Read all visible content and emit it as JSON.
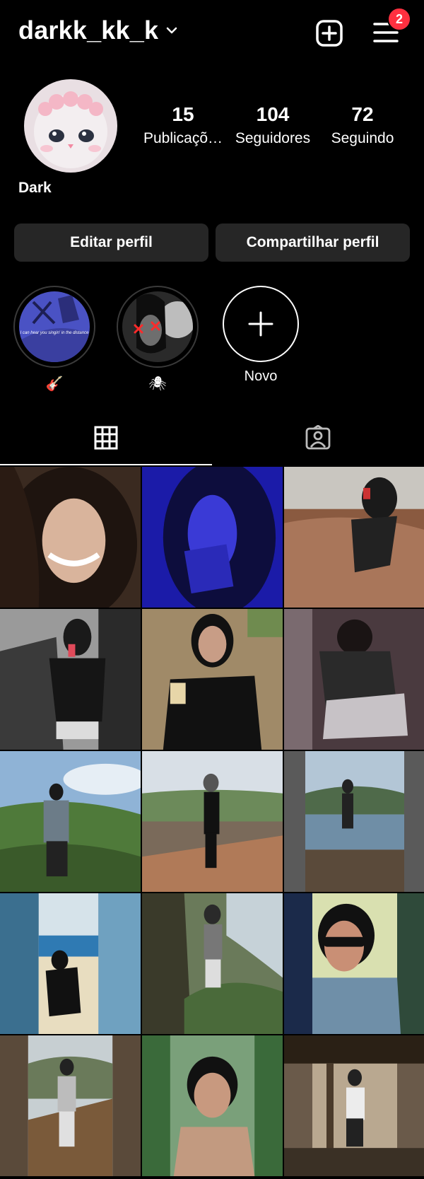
{
  "header": {
    "username": "darkk_kk_k",
    "notification_count": "2",
    "icons": [
      "chevron-down-icon",
      "add-post-icon",
      "menu-icon"
    ]
  },
  "profile": {
    "display_name": "Dark",
    "stats": [
      {
        "value": "15",
        "label": "Publicaçõ…"
      },
      {
        "value": "104",
        "label": "Seguidores"
      },
      {
        "value": "72",
        "label": "Seguindo"
      }
    ]
  },
  "buttons": {
    "edit": "Editar perfil",
    "share": "Compartilhar perfil"
  },
  "highlights": [
    {
      "label": "🎸",
      "image_text": "I can hear you singin' in the distance"
    },
    {
      "label": "🕷"
    },
    {
      "label": "Novo"
    }
  ],
  "tabs": [
    {
      "name": "grid-tab",
      "icon": "grid-icon",
      "active": true
    },
    {
      "name": "tagged-tab",
      "icon": "tagged-person-icon",
      "active": false
    }
  ],
  "colors": {
    "background": "#000000",
    "button": "#262626",
    "badge": "#ff3040"
  }
}
